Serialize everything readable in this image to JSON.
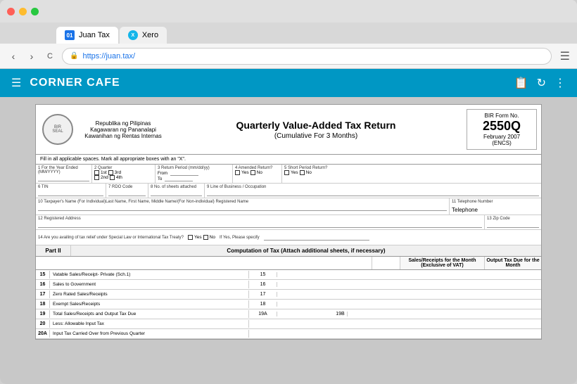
{
  "browser": {
    "tab1_label": "Juan Tax",
    "tab2_label": "Xero",
    "url": "https://juan.tax/",
    "nav_back": "‹",
    "nav_forward": "›",
    "nav_refresh": "C"
  },
  "app": {
    "title": "CORNER CAFE",
    "icon_doc": "📄",
    "icon_refresh": "🔄",
    "icon_menu": "⋮"
  },
  "form": {
    "agency_line1": "Republika ng Pilipinas",
    "agency_line2": "Kagawaran ng Pananalapi",
    "agency_line3": "Kawanihan ng Rentas Internas",
    "title": "Quarterly Value-Added Tax Return",
    "subtitle": "(Cumulative For 3 Months)",
    "bir_label": "BIR Form No.",
    "form_number": "2550Q",
    "form_date": "February 2007",
    "form_encs": "(ENCS)",
    "instructions": "Fill in all applicable spaces. Mark all appropriate boxes with an \"X\".",
    "field1_label": "1 For the Year Ended (MM/YYYY)",
    "field2_label": "2 Quarter",
    "q1": "1st",
    "q2": "2nd",
    "q3": "3rd",
    "q4": "4th",
    "field3_label": "3 Return Period (mm/dd/yy)",
    "field3_from": "From",
    "field3_to": "To",
    "field4_label": "4 Amended Return?",
    "field4_yes": "Yes",
    "field4_no": "No",
    "field5_label": "5 Short Period Return?",
    "field5_yes": "Yes",
    "field5_no": "No",
    "field6_label": "6 TIN",
    "field7_label": "7 RDO Code",
    "field8_label": "8 No. of sheets attached",
    "field9_label": "9 Line of Business / Occupation",
    "field10_label": "10 Taxpayer's Name (For Individual)Last Name, First Name, Middle Name/(For Non-individual) Registered Name",
    "field11_label": "11 Telephone Number",
    "field11_value": "Telephone",
    "field12_label": "12 Registered Address",
    "field13_label": "13 Zip Code",
    "field14_label": "14 Are you availing of tax relief under Special Law or International Tax Treaty?",
    "field14_yes": "Yes",
    "field14_no": "No",
    "field14_specify_label": "If Yes, Please specify",
    "part2_label": "Part II",
    "part2_title": "Computation of Tax (Attach additional sheets, if necessary)",
    "col1_header": "Sales/Receipts for the Month (Exclusive of VAT)",
    "col2_header": "Output Tax Due for the Month",
    "row15_num": "15",
    "row15_label": "Vatable Sales/Receipt- Private (Sch.1)",
    "row15_col": "15",
    "row16_num": "16",
    "row16_label": "Sales to Government",
    "row16_col": "16",
    "row17_num": "17",
    "row17_label": "Zero Rated Sales/Receipts",
    "row17_col": "17",
    "row18_num": "18",
    "row18_label": "Exempt Sales/Receipts",
    "row18_col": "18",
    "row19_num": "19",
    "row19_label": "Total Sales/Receipts and Output Tax Due",
    "row19_col": "19A",
    "row19_col2": "19B",
    "row20_num": "20",
    "row20_label": "Less: Allowable Input Tax",
    "row20a_num": "20A",
    "row20a_label": "Input Tax Carried Over from Previous Quarter"
  }
}
